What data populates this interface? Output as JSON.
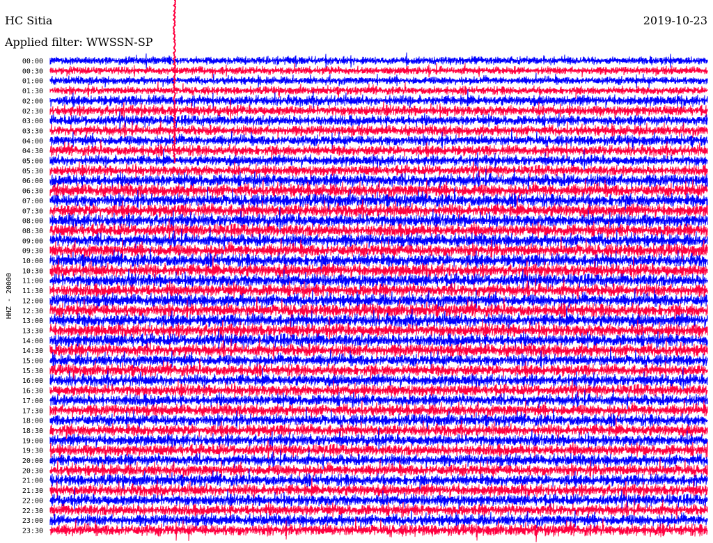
{
  "header": {
    "station": "HC Sitia",
    "date": "2019-10-23",
    "filter": "Applied filter: WWSSN-SP"
  },
  "chart_data": {
    "type": "line",
    "title": "HC Sitia",
    "date": "2019-10-23",
    "filter": "WWSSN-SP",
    "ylabel": "HHZ - 20000",
    "rows": [
      "00:00",
      "00:30",
      "01:00",
      "01:30",
      "02:00",
      "02:30",
      "03:00",
      "03:30",
      "04:00",
      "04:30",
      "05:00",
      "05:30",
      "06:00",
      "06:30",
      "07:00",
      "07:30",
      "08:00",
      "08:30",
      "09:00",
      "09:30",
      "10:00",
      "10:30",
      "11:00",
      "11:30",
      "12:00",
      "12:30",
      "13:00",
      "13:30",
      "14:00",
      "14:30",
      "15:00",
      "15:30",
      "16:00",
      "16:30",
      "17:00",
      "17:30",
      "18:00",
      "18:30",
      "19:00",
      "19:30",
      "20:00",
      "20:30",
      "21:00",
      "21:30",
      "22:00",
      "22:30",
      "23:00",
      "23:30"
    ],
    "trace_colors": [
      "#0000ff",
      "#ff0040"
    ],
    "grid": false
  }
}
